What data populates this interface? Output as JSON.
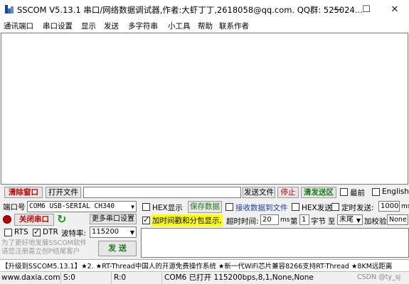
{
  "window": {
    "title": "SSCOM V5.13.1 串口/网络数据调试器,作者:大虾丁丁,2618058@qq.com. QQ群: 525024...",
    "minimize": "—",
    "maximize": "☐",
    "close": "✕"
  },
  "menu": [
    "通讯端口",
    "串口设置",
    "显示",
    "发送",
    "多字符串",
    "小工具",
    "帮助",
    "联系作者"
  ],
  "toolbar": {
    "clear_window": "清除窗口",
    "open_file": "打开文件",
    "file_path": "",
    "send_file": "发送文件",
    "stop": "停止",
    "clear_send": "清发送区",
    "latest_label": "最前",
    "latest_checked": false,
    "english_label": "English",
    "english_checked": false
  },
  "port": {
    "label": "端口号",
    "value": "COM6 USB-SERIAL CH340",
    "close_port": "关闭串口",
    "more_settings": "更多串口设置",
    "rts_label": "RTS",
    "rts_checked": false,
    "dtr_label": "DTR",
    "dtr_checked": true,
    "baud_label": "波特率:",
    "baud_value": "115200",
    "promo": "为了更好地发展SSCOM软件\n请您注册嘉立创P结尾客户",
    "send_button": "发 送"
  },
  "display": {
    "hex_display_label": "HEX显示",
    "hex_display_checked": false,
    "save_data": "保存数据",
    "recv_to_file_label": "接收数据到文件",
    "recv_to_file_checked": false,
    "timestamp_label": "加时间戳和分包显示,",
    "timestamp_checked": true,
    "timeout_label": "超时时间:",
    "timeout_value": "20",
    "timeout_unit": "ms",
    "byte_label_1": "第",
    "byte_index": "1",
    "byte_label_2": "字节",
    "byte_label_3": "至",
    "byte_end": "末尾",
    "checksum_label": "加校验",
    "checksum_value": "None"
  },
  "send": {
    "hex_send_label": "HEX发送",
    "hex_send_checked": false,
    "timed_send_label": "定时发送:",
    "timed_send_checked": false,
    "interval_value": "1000",
    "interval_unit": "ms"
  },
  "ticker": "【升级到SSCOM5.13.1】★2. ★RT-Thread中国人的开源免费操作系统 ★新一代WiFi芯片兼容8266支持RT-Thread ★8KM远距离",
  "status": {
    "site": "www.daxia.com",
    "sent": "S:0",
    "received": "R:0",
    "port_state": "COM6 已打开  115200bps,8,1,None,None",
    "watermark": "CSDN @ty_sj"
  }
}
